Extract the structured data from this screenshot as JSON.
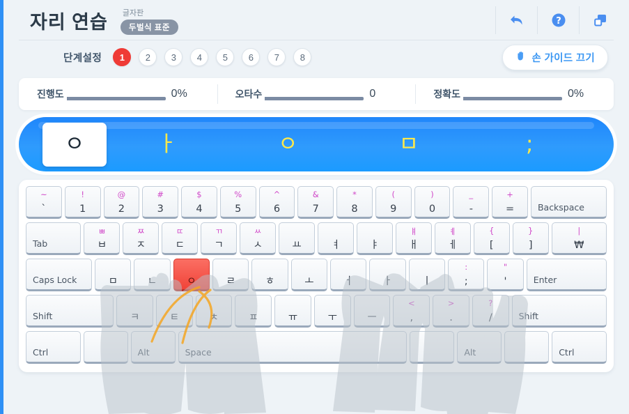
{
  "header": {
    "title": "자리 연습",
    "layout_caption": "글자판",
    "layout_badge": "두벌식 표준",
    "tools": [
      {
        "name": "back-icon",
        "label": "뒤로"
      },
      {
        "name": "help-icon",
        "label": "도움말"
      },
      {
        "name": "window-icon",
        "label": "창"
      }
    ]
  },
  "steps": {
    "label": "단계설정",
    "items": [
      "1",
      "2",
      "3",
      "4",
      "5",
      "6",
      "7",
      "8"
    ],
    "active": "1",
    "active_color": "#ef3b36"
  },
  "hand_guide": {
    "icon": "hand-icon",
    "label": "손 가이드 끄기",
    "color": "#3b97f3"
  },
  "stats": [
    {
      "name": "진행도",
      "value": "0%"
    },
    {
      "name": "오타수",
      "value": "0"
    },
    {
      "name": "정확도",
      "value": "0%"
    }
  ],
  "practice": {
    "chars": [
      "ㅇ",
      "ㅏ",
      "ㅇ",
      "ㅁ",
      ";"
    ],
    "current_index": 0,
    "strip_color": "#2f9bfd",
    "char_color": "#ffe94a",
    "current_color": "#1d2a36"
  },
  "keyboard": {
    "highlight_key": "ㅇ",
    "highlight_color": "#f04439",
    "rows": [
      [
        {
          "main": "`",
          "sub": "~",
          "w": "w-100"
        },
        {
          "main": "1",
          "sub": "!",
          "w": "w-100"
        },
        {
          "main": "2",
          "sub": "@",
          "w": "w-100"
        },
        {
          "main": "3",
          "sub": "#",
          "w": "w-100"
        },
        {
          "main": "4",
          "sub": "$",
          "w": "w-100"
        },
        {
          "main": "5",
          "sub": "%",
          "w": "w-100"
        },
        {
          "main": "6",
          "sub": "^",
          "w": "w-100"
        },
        {
          "main": "7",
          "sub": "&",
          "w": "w-100"
        },
        {
          "main": "8",
          "sub": "*",
          "w": "w-100"
        },
        {
          "main": "9",
          "sub": "(",
          "w": "w-100"
        },
        {
          "main": "0",
          "sub": ")",
          "w": "w-100"
        },
        {
          "main": "-",
          "sub": "_",
          "w": "w-100"
        },
        {
          "main": "=",
          "sub": "+",
          "w": "w-100"
        },
        {
          "main": "Backspace",
          "sub": "",
          "w": "w-backspace",
          "wide": true
        }
      ],
      [
        {
          "main": "Tab",
          "sub": "",
          "w": "w-tab",
          "wide": true
        },
        {
          "main": "ㅂ",
          "sub": "ㅃ",
          "w": "w-100"
        },
        {
          "main": "ㅈ",
          "sub": "ㅉ",
          "w": "w-100"
        },
        {
          "main": "ㄷ",
          "sub": "ㄸ",
          "w": "w-100"
        },
        {
          "main": "ㄱ",
          "sub": "ㄲ",
          "w": "w-100"
        },
        {
          "main": "ㅅ",
          "sub": "ㅆ",
          "w": "w-100"
        },
        {
          "main": "ㅛ",
          "sub": "",
          "w": "w-100"
        },
        {
          "main": "ㅕ",
          "sub": "",
          "w": "w-100"
        },
        {
          "main": "ㅑ",
          "sub": "",
          "w": "w-100"
        },
        {
          "main": "ㅐ",
          "sub": "ㅒ",
          "w": "w-100"
        },
        {
          "main": "ㅔ",
          "sub": "ㅖ",
          "w": "w-100"
        },
        {
          "main": "[",
          "sub": "{",
          "w": "w-100"
        },
        {
          "main": "]",
          "sub": "}",
          "w": "w-100"
        },
        {
          "main": "₩",
          "sub": "|",
          "w": "w-bslash"
        }
      ],
      [
        {
          "main": "Caps Lock",
          "sub": "",
          "w": "w-caps",
          "wide": true
        },
        {
          "main": "ㅁ",
          "sub": "",
          "w": "w-100"
        },
        {
          "main": "ㄴ",
          "sub": "",
          "w": "w-100"
        },
        {
          "main": "ㅇ",
          "sub": "",
          "w": "w-100"
        },
        {
          "main": "ㄹ",
          "sub": "",
          "w": "w-100"
        },
        {
          "main": "ㅎ",
          "sub": "",
          "w": "w-100"
        },
        {
          "main": "ㅗ",
          "sub": "",
          "w": "w-100"
        },
        {
          "main": "ㅓ",
          "sub": "",
          "w": "w-100"
        },
        {
          "main": "ㅏ",
          "sub": "",
          "w": "w-100"
        },
        {
          "main": "ㅣ",
          "sub": "",
          "w": "w-100"
        },
        {
          "main": ";",
          "sub": ":",
          "w": "w-100"
        },
        {
          "main": "'",
          "sub": "\"",
          "w": "w-100"
        },
        {
          "main": "Enter",
          "sub": "",
          "w": "w-enter",
          "wide": true
        }
      ],
      [
        {
          "main": "Shift",
          "sub": "",
          "w": "w-lshift",
          "wide": true
        },
        {
          "main": "ㅋ",
          "sub": "",
          "w": "w-100"
        },
        {
          "main": "ㅌ",
          "sub": "",
          "w": "w-100"
        },
        {
          "main": "ㅊ",
          "sub": "",
          "w": "w-100"
        },
        {
          "main": "ㅍ",
          "sub": "",
          "w": "w-100"
        },
        {
          "main": "ㅠ",
          "sub": "",
          "w": "w-100"
        },
        {
          "main": "ㅜ",
          "sub": "",
          "w": "w-100"
        },
        {
          "main": "ㅡ",
          "sub": "",
          "w": "w-100"
        },
        {
          "main": ",",
          "sub": "<",
          "w": "w-100"
        },
        {
          "main": ".",
          "sub": ">",
          "w": "w-100"
        },
        {
          "main": "/",
          "sub": "?",
          "w": "w-100"
        },
        {
          "main": "Shift",
          "sub": "",
          "w": "w-rshift",
          "wide": true
        }
      ],
      [
        {
          "main": "Ctrl",
          "sub": "",
          "w": "w-ctrl",
          "wide": true
        },
        {
          "main": "",
          "sub": "",
          "w": "w-mod",
          "wide": true,
          "blank": true
        },
        {
          "main": "Alt",
          "sub": "",
          "w": "w-mod",
          "wide": true
        },
        {
          "main": "Space",
          "sub": "",
          "w": "w-space",
          "wide": true
        },
        {
          "main": "",
          "sub": "",
          "w": "w-mod",
          "wide": true,
          "blank": true
        },
        {
          "main": "Alt",
          "sub": "",
          "w": "w-mod",
          "wide": true
        },
        {
          "main": "",
          "sub": "",
          "w": "w-mod",
          "wide": true,
          "blank": true
        },
        {
          "main": "Ctrl",
          "sub": "",
          "w": "w-ctrl",
          "wide": true
        }
      ]
    ]
  }
}
